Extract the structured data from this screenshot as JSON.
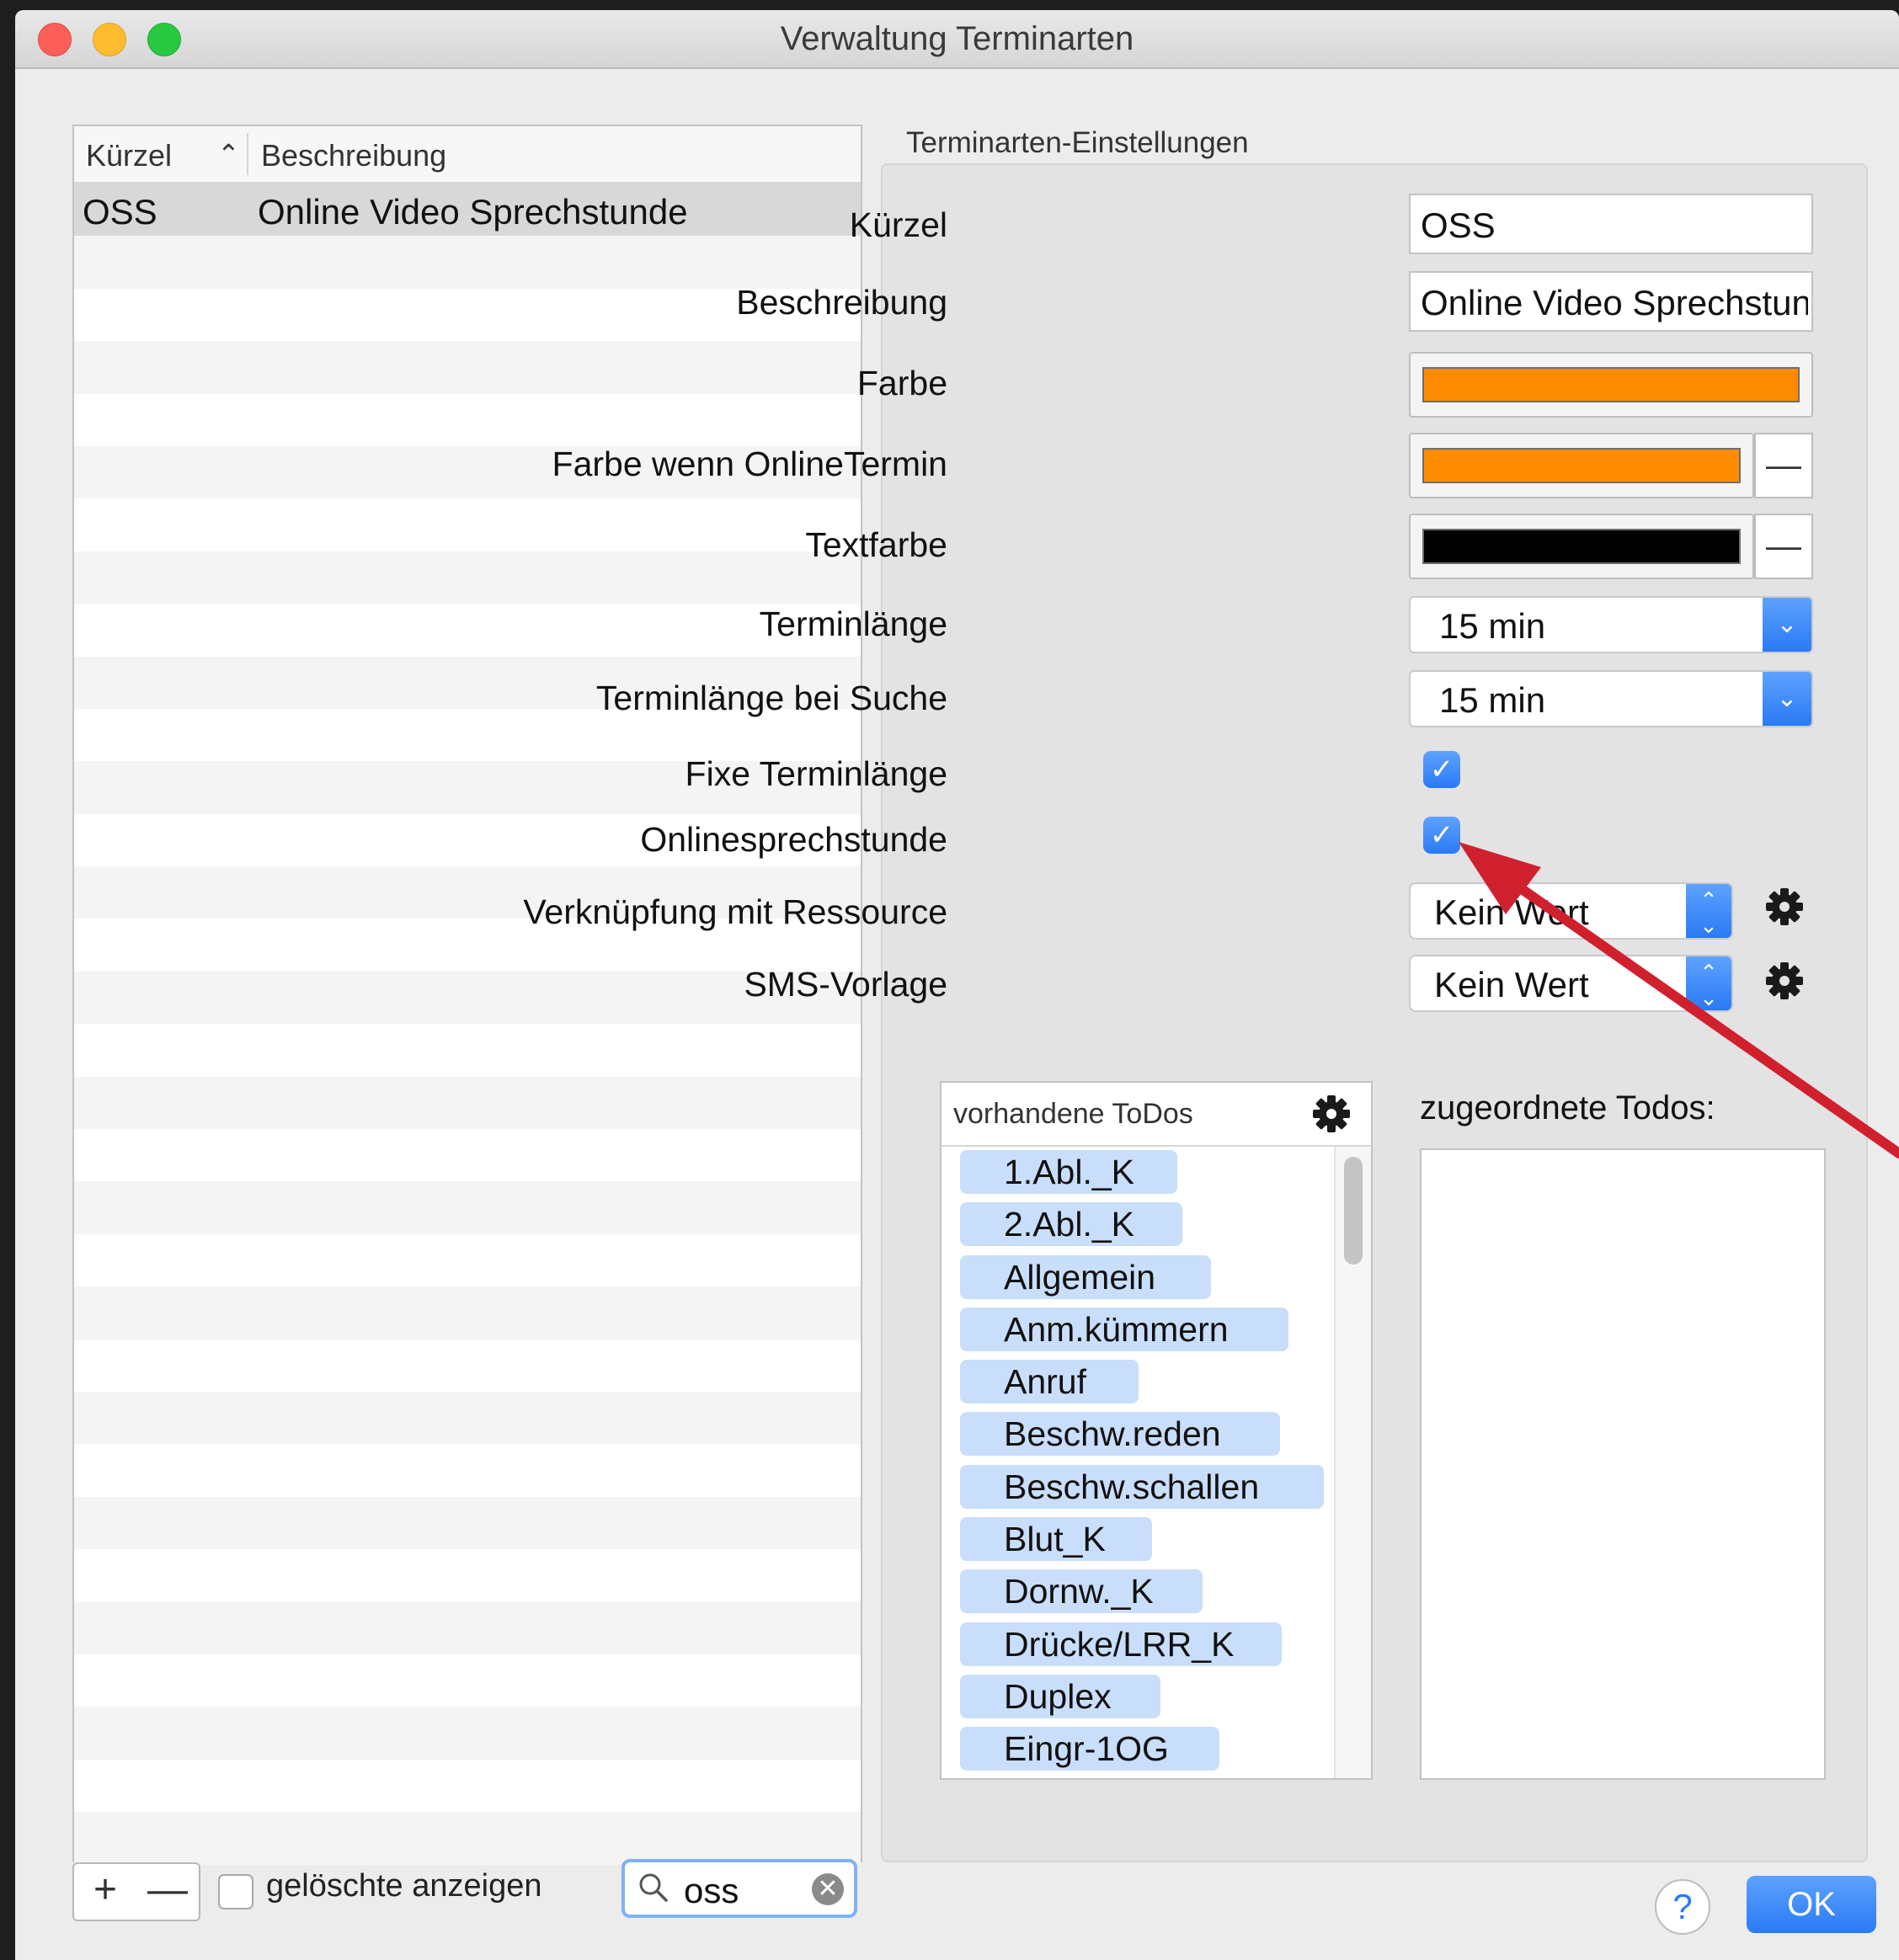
{
  "window": {
    "title": "Verwaltung Terminarten"
  },
  "table": {
    "columns": {
      "kurzel": "Kürzel",
      "beschreibung": "Beschreibung"
    },
    "rows": [
      {
        "kurzel": "OSS",
        "beschreibung": "Online Video Sprechstunde"
      }
    ]
  },
  "footer": {
    "add_label": "+",
    "remove_label": "—",
    "show_deleted_label": "gelöschte anzeigen",
    "search_value": "oss",
    "help_label": "?",
    "ok_label": "OK"
  },
  "settings": {
    "group_title": "Terminarten-Einstellungen",
    "kurzel_label": "Kürzel",
    "kurzel_value": "OSS",
    "beschreibung_label": "Beschreibung",
    "beschreibung_value": "Online Video Sprechstunde",
    "farbe_label": "Farbe",
    "farbe_color": "#ff8c00",
    "farbe_online_label": "Farbe wenn OnlineTermin",
    "farbe_online_color": "#ff8c00",
    "textfarbe_label": "Textfarbe",
    "textfarbe_color": "#000000",
    "minus_label": "—",
    "terminlaenge_label": "Terminlänge",
    "terminlaenge_value": "15 min",
    "terminlaenge_suche_label": "Terminlänge bei Suche",
    "terminlaenge_suche_value": "15 min",
    "fixe_label": "Fixe Terminlänge",
    "fixe_checked": true,
    "online_label": "Onlinesprechstunde",
    "online_checked": true,
    "ressource_label": "Verknüpfung mit Ressource",
    "ressource_value": "Kein Wert",
    "sms_label": "SMS-Vorlage",
    "sms_value": "Kein Wert"
  },
  "todos": {
    "available_title": "vorhandene ToDos",
    "assigned_title": "zugeordnete Todos:",
    "items": [
      "1.Abl._K",
      "2.Abl._K",
      "Allgemein",
      "Anm.kümmern",
      "Anruf",
      "Beschw.reden",
      "Beschw.schallen",
      "Blut_K",
      "Dornw._K",
      "Drücke/LRR_K",
      "Duplex",
      "Eingr-1OG"
    ]
  },
  "annotation": {
    "arrow_color": "#d0202e"
  }
}
